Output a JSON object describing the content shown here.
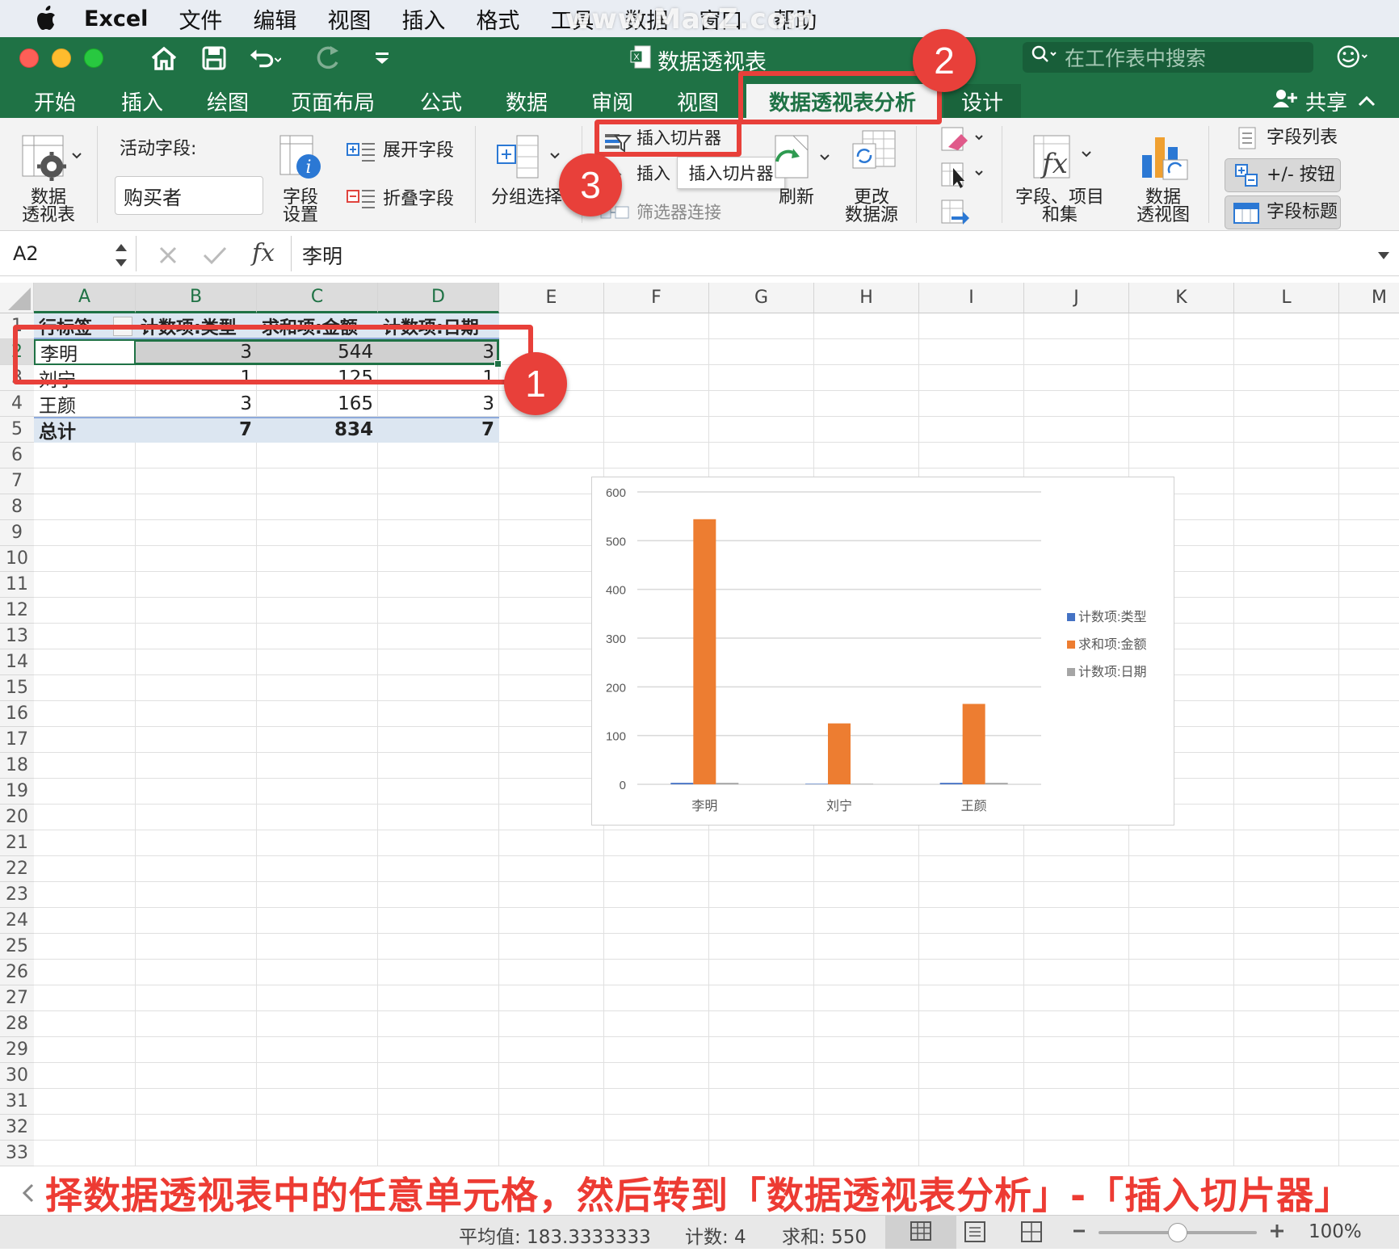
{
  "menubar": {
    "app": "Excel",
    "items": [
      "文件",
      "编辑",
      "视图",
      "插入",
      "格式",
      "工具",
      "数据",
      "窗口",
      "帮助"
    ],
    "watermark": "www.MacZ.com"
  },
  "window": {
    "title": "数据透视表",
    "search_placeholder": "在工作表中搜索",
    "share_label": "共享"
  },
  "tabs": [
    "开始",
    "插入",
    "绘图",
    "页面布局",
    "公式",
    "数据",
    "审阅",
    "视图",
    "数据透视表分析",
    "设计"
  ],
  "ribbon": {
    "pivot_table": "数据\n透视表",
    "active_field_label": "活动字段:",
    "active_field_value": "购买者",
    "field_settings": "字段\n设置",
    "expand_field": "展开字段",
    "collapse_field": "折叠字段",
    "group_select": "分组选择",
    "insert_slicer": "插入切片器",
    "insert_timeline": "插入",
    "tooltip": "插入切片器",
    "filter_connections": "筛选器连接",
    "refresh": "刷新",
    "change_source": "更改\n数据源",
    "fields_items_sets": "字段、项目\n和集",
    "pivot_chart": "数据\n透视图",
    "field_list": "字段列表",
    "plus_minus_buttons": "+/- 按钮",
    "field_headers": "字段标题"
  },
  "formula_bar": {
    "name_box": "A2",
    "fx": "fx",
    "value": "李明"
  },
  "columns": [
    "A",
    "B",
    "C",
    "D",
    "E",
    "F",
    "G",
    "H",
    "I",
    "J",
    "K",
    "L",
    "M"
  ],
  "rows": [
    "1",
    "2",
    "3",
    "4",
    "5",
    "6",
    "7",
    "8",
    "9",
    "10",
    "11",
    "12",
    "13",
    "14",
    "15",
    "16",
    "17",
    "18",
    "19",
    "20",
    "21",
    "22",
    "23",
    "24",
    "25",
    "26",
    "27",
    "28",
    "29",
    "30",
    "31",
    "32",
    "33"
  ],
  "table": {
    "headers": [
      "行标签",
      "计数项:类型",
      "求和项:金额",
      "计数项:日期"
    ],
    "data": [
      [
        "李明",
        "3",
        "544",
        "3"
      ],
      [
        "刘宁",
        "1",
        "125",
        "1"
      ],
      [
        "王颜",
        "3",
        "165",
        "3"
      ]
    ],
    "total": [
      "总计",
      "7",
      "834",
      "7"
    ]
  },
  "chart_data": {
    "type": "bar",
    "categories": [
      "李明",
      "刘宁",
      "王颜"
    ],
    "series": [
      {
        "name": "计数项:类型",
        "values": [
          3,
          1,
          3
        ],
        "color": "#4472c4"
      },
      {
        "name": "求和项:金额",
        "values": [
          544,
          125,
          165
        ],
        "color": "#ed7d31"
      },
      {
        "name": "计数项:日期",
        "values": [
          3,
          1,
          3
        ],
        "color": "#a5a5a5"
      }
    ],
    "ylim": [
      0,
      600
    ],
    "yticks": [
      "0",
      "100",
      "200",
      "300",
      "400",
      "500",
      "600"
    ],
    "legend": "right",
    "grid": true
  },
  "annotations": {
    "badges": [
      "1",
      "2",
      "3"
    ],
    "caption": "择数据透视表中的任意单元格，然后转到「数据透视表分析」-「插入切片器」"
  },
  "statusbar": {
    "average": "平均值: 183.3333333",
    "count": "计数: 4",
    "sum": "求和: 550",
    "zoom": "100%"
  }
}
